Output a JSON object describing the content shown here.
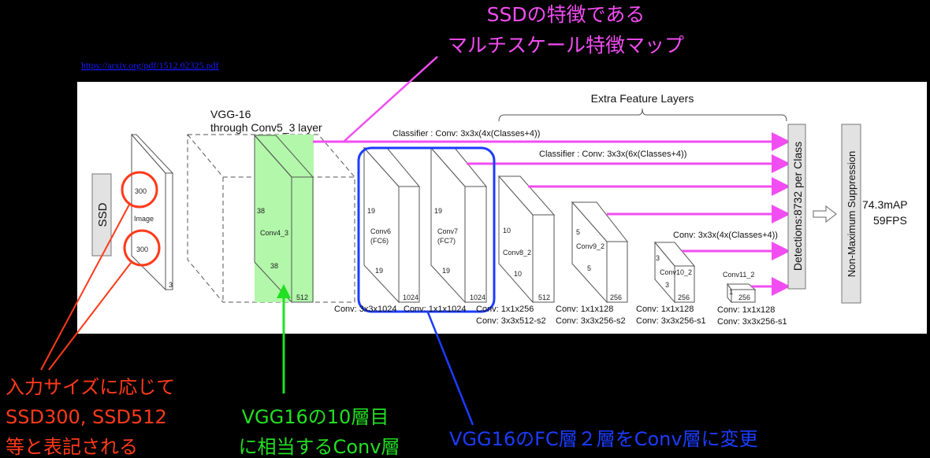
{
  "source_link": "https://arxiv.org/pdf/1512.02325.pdf",
  "headline": {
    "line1": "SSDの特徴である",
    "line2": "マルチスケール特徴マップ"
  },
  "colors": {
    "magenta": "#f24df2",
    "red": "#ff3a1a",
    "green": "#22e022",
    "blue": "#1c3cff",
    "highlight": "#b2f7aa"
  },
  "diagram": {
    "ssd_label": "SSD",
    "vgg_title": "VGG-16",
    "vgg_subtitle": "through Conv5_3 layer",
    "extra_layers_title": "Extra Feature Layers",
    "classifier_1": "Classifier : Conv: 3x3x(4x(Classes+4))",
    "classifier_2": "Classifier : Conv: 3x3x(6x(Classes+4))",
    "classifier_3": "Conv: 3x3x(4x(Classes+4))",
    "detections": "Detections:8732  per Class",
    "nms": "Non-Maximum Suppression",
    "map": "74.3mAP",
    "fps": "59FPS",
    "image": {
      "h": "300",
      "w": "300",
      "c": "3",
      "name": "Image"
    },
    "conv4_3": {
      "h": "38",
      "w": "38",
      "c": "512",
      "name": "Conv4_3"
    },
    "conv6": {
      "h": "19",
      "w": "19",
      "c": "1024",
      "name": "Conv6",
      "sub": "(FC6)"
    },
    "conv7": {
      "h": "19",
      "w": "19",
      "c": "1024",
      "name": "Conv7",
      "sub": "(FC7)"
    },
    "conv8_2": {
      "h": "10",
      "w": "10",
      "c": "512",
      "name": "Conv8_2"
    },
    "conv9_2": {
      "h": "5",
      "w": "5",
      "c": "256",
      "name": "Conv9_2"
    },
    "conv10_2": {
      "h": "3",
      "w": "3",
      "c": "256",
      "name": "Conv10_2"
    },
    "conv11_2": {
      "h": "1",
      "c": "256",
      "name": "Conv11_2"
    },
    "ops": {
      "conv6": "Conv: 3x3x1024",
      "conv7": "Conv: 1x1x1024",
      "conv8_a": "Conv: 1x1x256",
      "conv8_b": "Conv:  3x3x512-s2",
      "conv9_a": "Conv: 1x1x128",
      "conv9_b": "Conv: 3x3x256-s2",
      "conv10_a": "Conv: 1x1x128",
      "conv10_b": "Conv: 3x3x256-s1",
      "conv11_a": "Conv: 1x1x128",
      "conv11_b": "Conv: 3x3x256-s1"
    }
  },
  "notes": {
    "red": {
      "line1": "入力サイズに応じて",
      "line2": "SSD300, SSD512",
      "line3": "等と表記される"
    },
    "green": {
      "line1": "VGG16の10層目",
      "line2": "に相当するConv層"
    },
    "blue": "VGG16のFC層２層をConv層に変更"
  }
}
